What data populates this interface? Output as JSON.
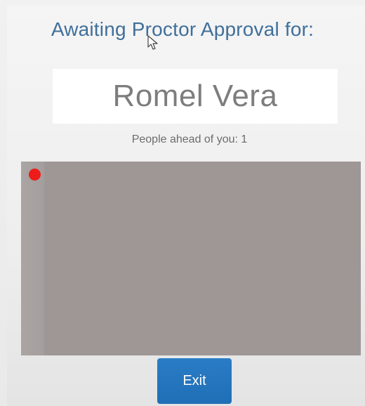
{
  "screen": {
    "heading": "Awaiting Proctor Approval for:",
    "student_name": "Romel Vera",
    "queue_text": "People ahead of you: 1",
    "exit_label": "Exit"
  },
  "icons": {
    "cursor": "mouse-pointer-icon",
    "recording": "recording-indicator-icon"
  },
  "colors": {
    "heading": "#3f6f9a",
    "recording_dot": "#ee1b1b",
    "exit_button": "#1f6fb6",
    "video_background": "#9e9796"
  }
}
